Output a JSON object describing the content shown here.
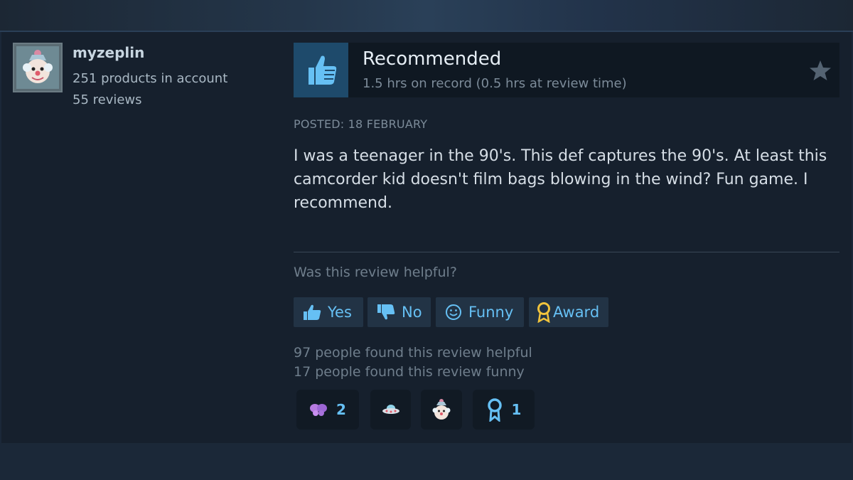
{
  "user": {
    "name": "myzeplin",
    "products": "251 products in account",
    "reviews": "55 reviews"
  },
  "review": {
    "verdict": "Recommended",
    "hours": "1.5 hrs on record (0.5 hrs at review time)",
    "posted": "POSTED: 18 FEBRUARY",
    "text": "I was a teenager in the 90's. This def captures the 90's. At least this camcorder kid doesn't film bags blowing in the wind? Fun game. I recommend."
  },
  "feedback": {
    "question": "Was this review helpful?",
    "yes_label": "Yes",
    "no_label": "No",
    "funny_label": "Funny",
    "award_label": "Award",
    "helpful_count": "97 people found this review helpful",
    "funny_count": "17 people found this review funny"
  },
  "awards": [
    {
      "icon": "butterfly-icon",
      "count": "2"
    },
    {
      "icon": "ufo-icon",
      "count": ""
    },
    {
      "icon": "clown-face-icon",
      "count": ""
    },
    {
      "icon": "ribbon-icon",
      "count": "1"
    }
  ],
  "colors": {
    "accent": "#66c0f4",
    "background": "#1b2838",
    "card": "#16202d"
  }
}
